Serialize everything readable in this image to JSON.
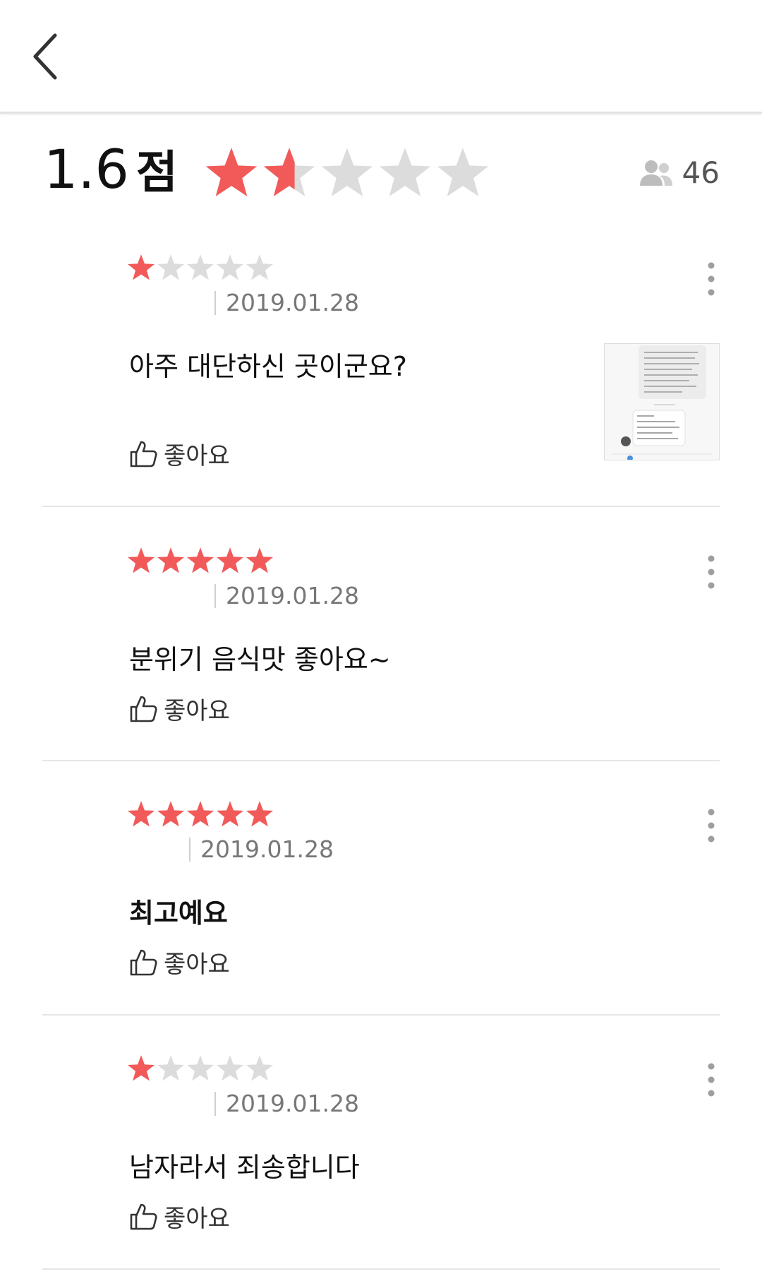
{
  "app_bar": {
    "back_icon": "chevron-left-icon"
  },
  "summary": {
    "score": "1.6",
    "score_unit": "점",
    "rating_value": 1.6,
    "rating_max": 5,
    "reviewer_count": "46",
    "reviewer_icon": "people-icon"
  },
  "colors": {
    "star_on": "#f25a5a",
    "star_off": "#dcdcdc",
    "accent": "#f25a5a"
  },
  "reviews": [
    {
      "rating": 1,
      "date": "2019.01.28",
      "text": "아주 대단하신 곳이군요?",
      "like_label": "좋아요",
      "has_photo": true
    },
    {
      "rating": 5,
      "date": "2019.01.28",
      "text": "분위기 음식맛 좋아요~",
      "like_label": "좋아요",
      "has_photo": false
    },
    {
      "rating": 5,
      "date": "2019.01.28",
      "text": "최고예요",
      "like_label": "좋아요",
      "has_photo": false
    },
    {
      "rating": 1,
      "date": "2019.01.28",
      "text": "남자라서 죄송합니다",
      "like_label": "좋아요",
      "has_photo": false
    }
  ]
}
